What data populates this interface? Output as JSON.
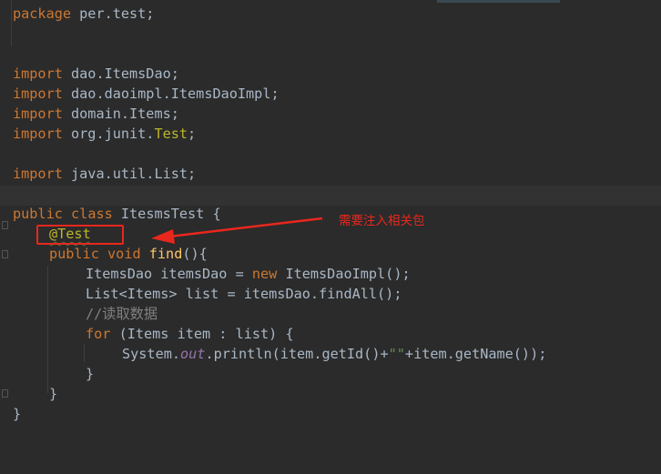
{
  "code": {
    "l1": {
      "kw": "package",
      "rest": " per.test;"
    },
    "l2": {
      "kw": "import",
      "rest": " dao.ItemsDao;"
    },
    "l3": {
      "kw": "import",
      "rest": " dao.daoimpl.ItemsDaoImpl;"
    },
    "l4": {
      "kw": "import",
      "rest": " domain.Items;"
    },
    "l5": {
      "kw": "import",
      "pre": " org.junit.",
      "ann": "Test",
      "semi": ";"
    },
    "l6": {
      "kw": "import",
      "rest": " java.util.List;"
    },
    "l7": {
      "kw1": "public",
      "kw2": "class",
      "rest": " ItesmsTest {"
    },
    "l8": {
      "ann": "@Test"
    },
    "l9": {
      "kw1": "public",
      "kw2": "void",
      "fn": "find",
      "rest": "(){"
    },
    "l10": {
      "a": "ItemsDao itemsDao = ",
      "kw": "new",
      "b": " ItemsDaoImpl();"
    },
    "l11": {
      "text": "List<Items> list = itemsDao.findAll();"
    },
    "l12": {
      "comment": "//读取数据"
    },
    "l13": {
      "kw": "for",
      "rest": " (Items item : list) {"
    },
    "l14": {
      "a": "System.",
      "fld": "out",
      "b": ".println(item.getId()+",
      "str": "\"\"",
      "c": "+item.getName());"
    },
    "l15": {
      "text": "}"
    },
    "l16": {
      "text": "}"
    },
    "l17": {
      "text": "}"
    }
  },
  "annotation": {
    "note": "需要注入相关包"
  }
}
